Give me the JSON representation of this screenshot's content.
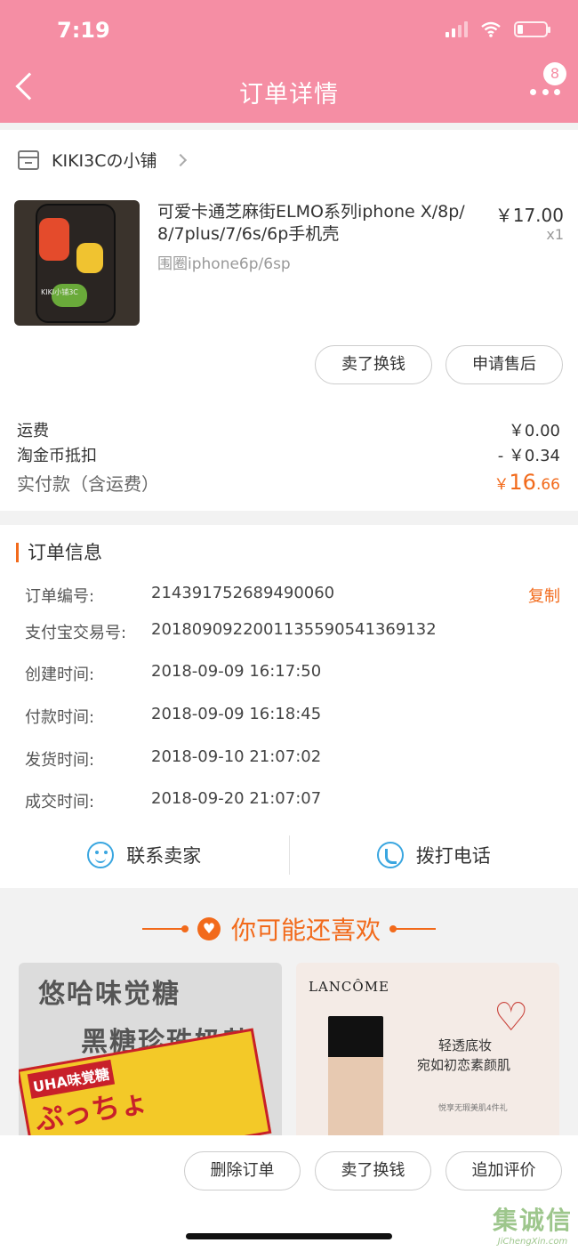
{
  "status_bar": {
    "time": "7:19"
  },
  "nav": {
    "title": "订单详情",
    "badge_count": "8"
  },
  "shop": {
    "name": "KIKI3Cの小铺"
  },
  "product": {
    "thumb_brand": "KIKI小铺3C",
    "title": "可爱卡通芝麻街ELMO系列iphone X/8p/ 8/7plus/7/6s/6p手机壳",
    "spec": "围圈iphone6p/6sp",
    "price": "￥17.00",
    "qty": "x1"
  },
  "item_actions": {
    "sell": "卖了换钱",
    "after_sale": "申请售后"
  },
  "fees": {
    "shipping_label": "运费",
    "shipping_value": "￥0.00",
    "coin_label": "淘金币抵扣",
    "coin_value": "- ￥0.34",
    "paid_label": "实付款（含运费）",
    "paid_currency": "￥",
    "paid_int": "16",
    "paid_dec": ".66"
  },
  "order_info": {
    "title": "订单信息",
    "copy_label": "复制",
    "rows": [
      {
        "label": "订单编号:",
        "value": "214391752689490060"
      },
      {
        "label": "支付宝交易号:",
        "value": "2018090922001135590541369132"
      },
      {
        "label": "创建时间:",
        "value": "2018-09-09 16:17:50"
      },
      {
        "label": "付款时间:",
        "value": "2018-09-09 16:18:45"
      },
      {
        "label": "发货时间:",
        "value": "2018-09-10 21:07:02"
      },
      {
        "label": "成交时间:",
        "value": "2018-09-20 21:07:07"
      }
    ]
  },
  "contact": {
    "seller": "联系卖家",
    "call": "拨打电话"
  },
  "recommend": {
    "heading": "你可能还喜欢",
    "items": [
      {
        "line1": "悠哈味觉糖",
        "line2": "黑糖珍珠奶茶",
        "tag": "UHA味覚糖",
        "jp": "ぷっちょ"
      },
      {
        "brand": "LANCÔME",
        "line1": "轻透底妆",
        "line2": "宛如初恋素颜肌",
        "promo": "悦享无瑕美肌4件礼"
      }
    ]
  },
  "bottom_actions": {
    "delete": "删除订单",
    "sell": "卖了换钱",
    "review": "追加评价"
  },
  "watermark": {
    "cn": "集诚信",
    "en": "JiChengXin.com"
  }
}
